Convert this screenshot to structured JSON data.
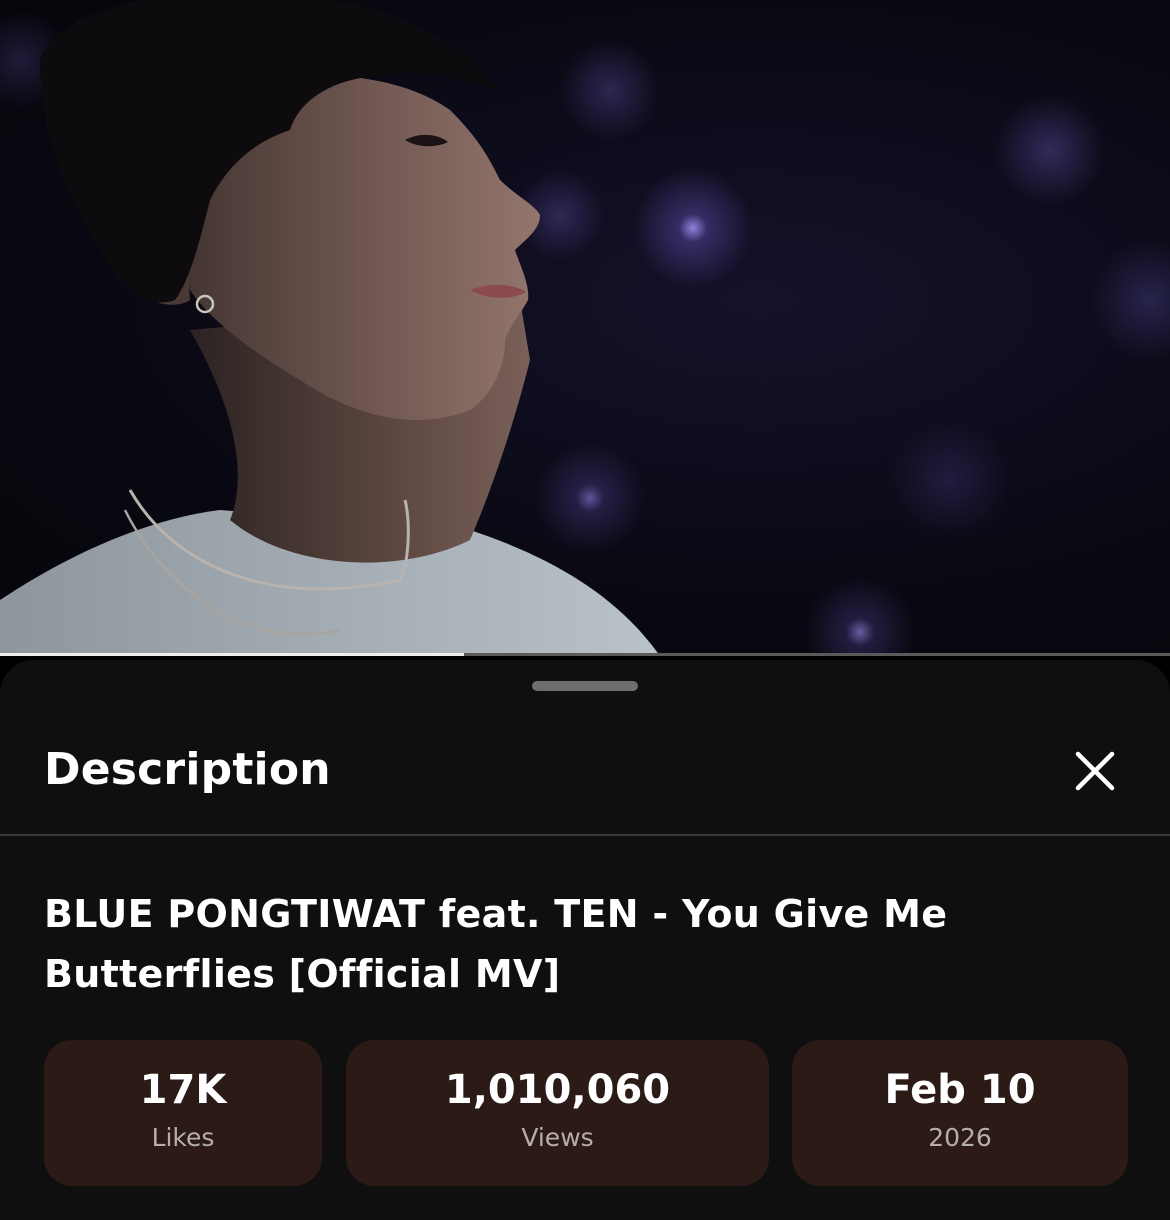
{
  "player": {
    "progress_fraction": 0.397
  },
  "sheet": {
    "title": "Description",
    "close_icon": "close-icon"
  },
  "video": {
    "title": "BLUE PONGTIWAT feat. TEN - You Give Me Butterflies [Official MV]"
  },
  "stats": {
    "likes_value": "17K",
    "likes_label": "Likes",
    "views_value": "1,010,060",
    "views_label": "Views",
    "date_value": "Feb 10",
    "date_label": "2026"
  },
  "colors": {
    "sheet_bg": "#0f0f0f",
    "card_bg": "#2b1a16",
    "secondary_text": "#b5aeab"
  }
}
